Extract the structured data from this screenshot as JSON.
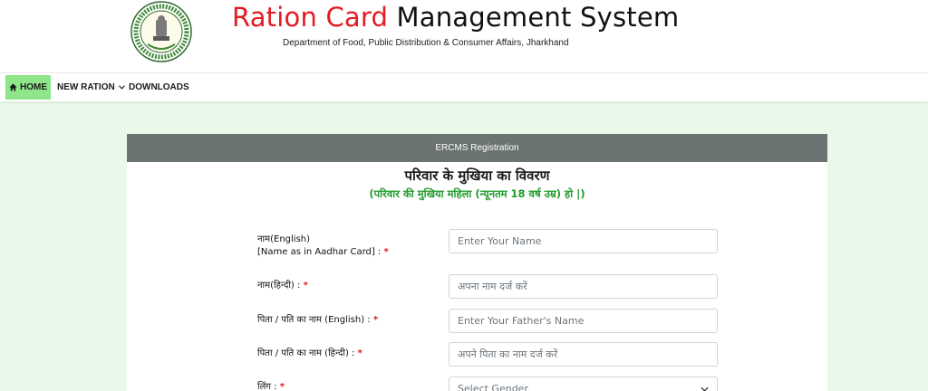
{
  "header": {
    "title_red": "Ration Card",
    "title_black": "Management System",
    "subtitle": "Department of Food, Public Distribution & Consumer Affairs, Jharkhand",
    "emblem_icon": "jharkhand-emblem-icon"
  },
  "nav": {
    "home": "HOME",
    "new_ration": "NEW RATION",
    "downloads": "DOWNLOADS",
    "home_bg": "#8ee58a"
  },
  "panel": {
    "title": "ERCMS Registration",
    "heading": "परिवार के मुखिया का विवरण",
    "note": "(परिवार की मुखिया महिला (न्यूनतम 18 वर्ष उम्र) हो |)"
  },
  "form": {
    "name_en_label_1": "नाम(English)",
    "name_en_label_2": "[Name as in Aadhar Card] :",
    "name_en_placeholder": "Enter Your Name",
    "name_hi_label": "नाम(हिन्दी) :",
    "name_hi_placeholder": "अपना नाम दर्ज करें",
    "father_en_label": "पिता / पति का नाम (English) :",
    "father_en_placeholder": "Enter Your Father's Name",
    "father_hi_label": "पिता / पति का नाम (हिन्दी) :",
    "father_hi_placeholder": "अपने पिता का नाम दर्ज करें",
    "gender_label": "लिंग :",
    "gender_value": "Select Gender",
    "required_mark": "*"
  },
  "colors": {
    "title_red": "#e31b23",
    "page_bg": "#eaf8ea",
    "panel_header": "#6b7373",
    "note_green": "#1f9a2a",
    "arrow": "#c4203a"
  }
}
